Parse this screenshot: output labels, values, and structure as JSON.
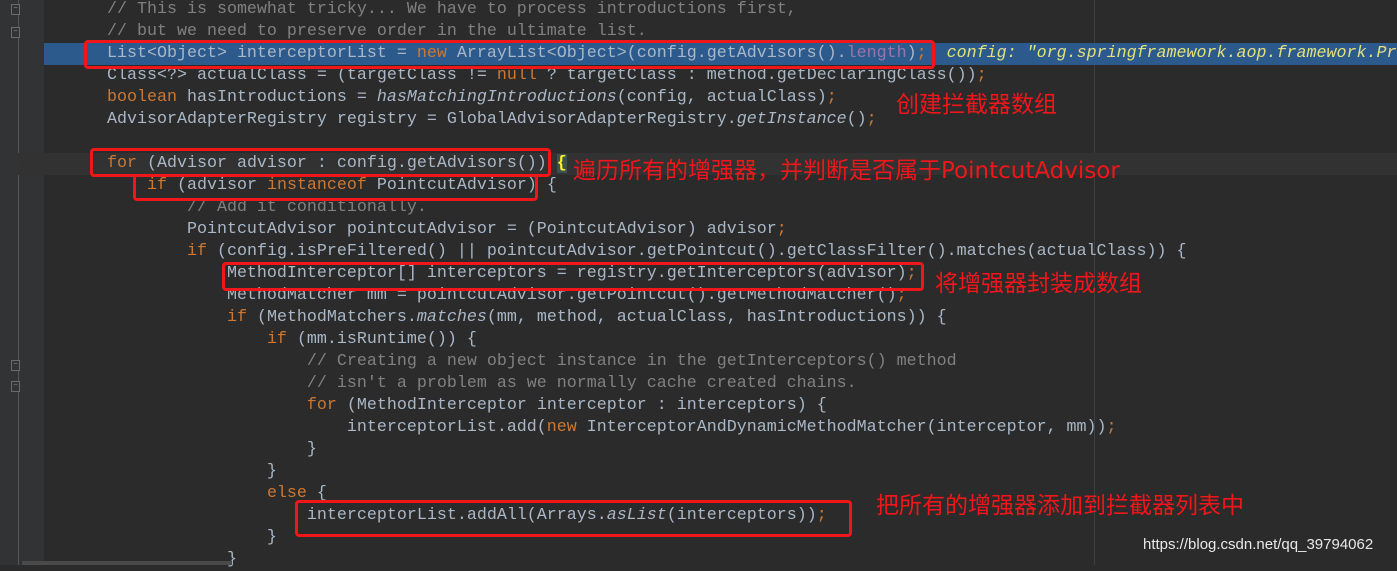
{
  "editor": {
    "lines": [
      {
        "tokens": [
          [
            "// This is somewhat tricky... We have to process introductions first,",
            "c"
          ]
        ]
      },
      {
        "tokens": [
          [
            "// but we need to preserve order in the ultimate list.",
            "c"
          ]
        ]
      },
      {
        "state": "sel",
        "tokens": [
          [
            "List<Object> interceptorList = ",
            "t"
          ],
          [
            "new ",
            "k"
          ],
          [
            "ArrayList<Object>(config.getAdvisors().",
            "t"
          ],
          [
            "length",
            "f"
          ],
          [
            ")",
            "t"
          ],
          [
            ";",
            "k"
          ],
          [
            "  config: \"org.springframework.aop.framework.Pr",
            "h"
          ]
        ]
      },
      {
        "tokens": [
          [
            "Class<?> actualClass = (targetClass != ",
            "t"
          ],
          [
            "null ",
            "k"
          ],
          [
            "? targetClass : method.getDeclaringClass())",
            "t"
          ],
          [
            ";",
            "k"
          ]
        ]
      },
      {
        "tokens": [
          [
            "boolean ",
            "k"
          ],
          [
            "hasIntroductions = ",
            "t"
          ],
          [
            "hasMatchingIntroductions",
            "i"
          ],
          [
            "(config, actualClass)",
            "t"
          ],
          [
            ";",
            "k"
          ]
        ]
      },
      {
        "tokens": [
          [
            "AdvisorAdapterRegistry registry = GlobalAdvisorAdapterRegistry.",
            "t"
          ],
          [
            "getInstance",
            "i"
          ],
          [
            "()",
            "t"
          ],
          [
            ";",
            "k"
          ]
        ]
      },
      {
        "tokens": []
      },
      {
        "state": "cur",
        "tokens": [
          [
            "for ",
            "k"
          ],
          [
            "(Advisor advisor : config.getAdvisors()) ",
            "t"
          ],
          [
            "{",
            "b"
          ]
        ]
      },
      {
        "tokens": [
          [
            "    ",
            "t"
          ],
          [
            "if ",
            "k"
          ],
          [
            "(advisor ",
            "t"
          ],
          [
            "instanceof ",
            "k"
          ],
          [
            "PointcutAdvisor) {",
            "t"
          ]
        ]
      },
      {
        "tokens": [
          [
            "        // Add it conditionally.",
            "c"
          ]
        ]
      },
      {
        "tokens": [
          [
            "        PointcutAdvisor pointcutAdvisor = (PointcutAdvisor) advisor",
            "t"
          ],
          [
            ";",
            "k"
          ]
        ]
      },
      {
        "tokens": [
          [
            "        ",
            "t"
          ],
          [
            "if ",
            "k"
          ],
          [
            "(config.isPreFiltered() || pointcutAdvisor.getPointcut().getClassFilter().matches(actualClass)) {",
            "t"
          ]
        ]
      },
      {
        "tokens": [
          [
            "            MethodInterceptor[] interceptors = registry.getInterceptors(advisor)",
            "t"
          ],
          [
            ";",
            "k"
          ]
        ]
      },
      {
        "tokens": [
          [
            "            MethodMatcher mm = pointcutAdvisor.getPointcut().getMethodMatcher()",
            "t"
          ],
          [
            ";",
            "k"
          ]
        ]
      },
      {
        "tokens": [
          [
            "            ",
            "t"
          ],
          [
            "if ",
            "k"
          ],
          [
            "(MethodMatchers.",
            "t"
          ],
          [
            "matches",
            "i"
          ],
          [
            "(mm, method, actualClass, hasIntroductions)) {",
            "t"
          ]
        ]
      },
      {
        "tokens": [
          [
            "                ",
            "t"
          ],
          [
            "if ",
            "k"
          ],
          [
            "(mm.isRuntime()) {",
            "t"
          ]
        ]
      },
      {
        "tokens": [
          [
            "                    // Creating a new object instance in the getInterceptors() method",
            "c"
          ]
        ]
      },
      {
        "tokens": [
          [
            "                    // isn't a problem as we normally cache created chains.",
            "c"
          ]
        ]
      },
      {
        "tokens": [
          [
            "                    ",
            "t"
          ],
          [
            "for ",
            "k"
          ],
          [
            "(MethodInterceptor interceptor : interceptors) {",
            "t"
          ]
        ]
      },
      {
        "tokens": [
          [
            "                        interceptorList.add(",
            "t"
          ],
          [
            "new ",
            "k"
          ],
          [
            "InterceptorAndDynamicMethodMatcher(interceptor, mm))",
            "t"
          ],
          [
            ";",
            "k"
          ]
        ]
      },
      {
        "tokens": [
          [
            "                    }",
            "t"
          ]
        ]
      },
      {
        "tokens": [
          [
            "                }",
            "t"
          ]
        ]
      },
      {
        "tokens": [
          [
            "                ",
            "t"
          ],
          [
            "else ",
            "k"
          ],
          [
            "{",
            "t"
          ]
        ]
      },
      {
        "tokens": [
          [
            "                    interceptorList.addAll(Arrays.",
            "t"
          ],
          [
            "asList",
            "i"
          ],
          [
            "(interceptors))",
            "t"
          ],
          [
            ";",
            "k"
          ]
        ]
      },
      {
        "tokens": [
          [
            "                }",
            "t"
          ]
        ]
      },
      {
        "tokens": [
          [
            "            }",
            "t"
          ]
        ]
      }
    ]
  },
  "annotations": {
    "create_array": "创建拦截器数组",
    "iterate_advisors": "遍历所有的增强器，并判断是否属于PointcutAdvisor",
    "wrap_array": "将增强器封装成数组",
    "add_all": "把所有的增强器添加到拦截器列表中"
  },
  "watermark": "https://blog.csdn.net/qq_39794062",
  "colors": {
    "background": "#2B2B2B",
    "keyword": "#CC7832",
    "comment": "#808080",
    "selection": "#2D5A8C",
    "annotation_red": "#F0161A"
  }
}
